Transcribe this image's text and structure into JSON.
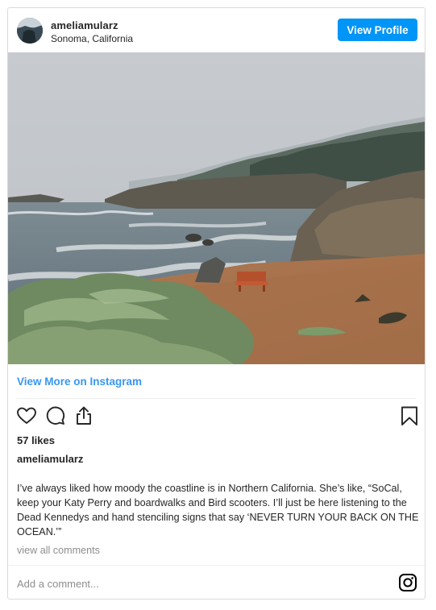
{
  "header": {
    "username": "ameliamularz",
    "location": "Sonoma, California",
    "view_profile_label": "View Profile"
  },
  "post": {
    "image_icon": "coastline-photo",
    "view_more_label": "View More on Instagram",
    "likes": "57 likes",
    "author": "ameliamularz",
    "caption": "I’ve always liked how moody the coastline is in Northern California. She’s like, “SoCal, keep your Katy Perry and boardwalks and Bird scooters. I’ll just be here listening to the Dead Kennedys and hand stenciling signs that say ‘NEVER TURN YOUR BACK ON THE OCEAN.’”",
    "view_comments_label": "view all comments",
    "comment_placeholder": "Add a comment..."
  },
  "icons": {
    "like": "heart-icon",
    "comment": "comment-icon",
    "share": "share-icon",
    "save": "bookmark-icon",
    "brand": "instagram-icon"
  },
  "colors": {
    "accent": "#0095f6",
    "link": "#3897f0",
    "text": "#262626",
    "muted": "#8e8e8e",
    "border": "#dbdbdb"
  }
}
